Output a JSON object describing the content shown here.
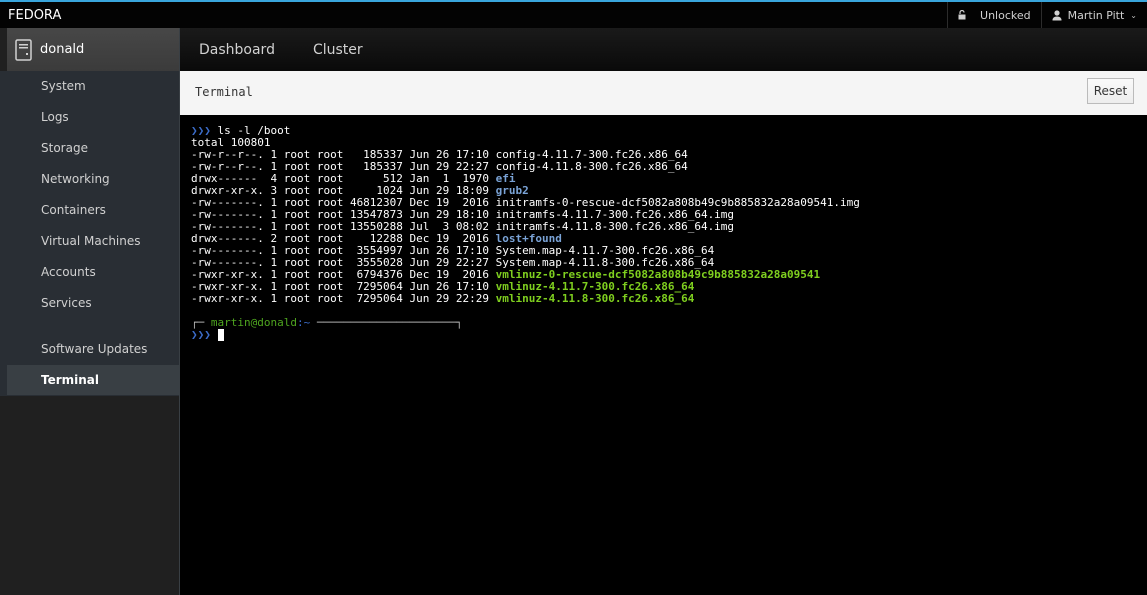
{
  "topbar": {
    "brand": "FEDORA",
    "lock_status": "Unlocked",
    "user_name": "Martin Pitt",
    "accent_color": "#39a5dc"
  },
  "sidebar": {
    "host": "donald",
    "items": [
      {
        "label": "System",
        "active": false
      },
      {
        "label": "Logs",
        "active": false
      },
      {
        "label": "Storage",
        "active": false
      },
      {
        "label": "Networking",
        "active": false
      },
      {
        "label": "Containers",
        "active": false
      },
      {
        "label": "Virtual Machines",
        "active": false
      },
      {
        "label": "Accounts",
        "active": false
      },
      {
        "label": "Services",
        "active": false
      },
      {
        "label": "Software Updates",
        "active": false
      },
      {
        "label": "Terminal",
        "active": true
      }
    ]
  },
  "mainnav": {
    "tabs": [
      "Dashboard",
      "Cluster"
    ]
  },
  "toolbar": {
    "title": "Terminal",
    "reset_label": "Reset"
  },
  "terminal": {
    "prompt_symbol": "❯❯❯",
    "command": "ls -l /boot",
    "total": "total 100801",
    "entries": [
      {
        "meta": "-rw-r--r--. 1 root root   185337 Jun 26 17:10 ",
        "name": "config-4.11.7-300.fc26.x86_64",
        "kind": "file"
      },
      {
        "meta": "-rw-r--r--. 1 root root   185337 Jun 29 22:27 ",
        "name": "config-4.11.8-300.fc26.x86_64",
        "kind": "file"
      },
      {
        "meta": "drwx------  4 root root      512 Jan  1  1970 ",
        "name": "efi",
        "kind": "dir"
      },
      {
        "meta": "drwxr-xr-x. 3 root root     1024 Jun 29 18:09 ",
        "name": "grub2",
        "kind": "dir"
      },
      {
        "meta": "-rw-------. 1 root root 46812307 Dec 19  2016 ",
        "name": "initramfs-0-rescue-dcf5082a808b49c9b885832a28a09541.img",
        "kind": "file"
      },
      {
        "meta": "-rw-------. 1 root root 13547873 Jun 29 18:10 ",
        "name": "initramfs-4.11.7-300.fc26.x86_64.img",
        "kind": "file"
      },
      {
        "meta": "-rw-------. 1 root root 13550288 Jul  3 08:02 ",
        "name": "initramfs-4.11.8-300.fc26.x86_64.img",
        "kind": "file"
      },
      {
        "meta": "drwx------. 2 root root    12288 Dec 19  2016 ",
        "name": "lost+found",
        "kind": "dir"
      },
      {
        "meta": "-rw-------. 1 root root  3554997 Jun 26 17:10 ",
        "name": "System.map-4.11.7-300.fc26.x86_64",
        "kind": "file"
      },
      {
        "meta": "-rw-------. 1 root root  3555028 Jun 29 22:27 ",
        "name": "System.map-4.11.8-300.fc26.x86_64",
        "kind": "file"
      },
      {
        "meta": "-rwxr-xr-x. 1 root root  6794376 Dec 19  2016 ",
        "name": "vmlinuz-0-rescue-dcf5082a808b49c9b885832a28a09541",
        "kind": "exec"
      },
      {
        "meta": "-rwxr-xr-x. 1 root root  7295064 Jun 26 17:10 ",
        "name": "vmlinuz-4.11.7-300.fc26.x86_64",
        "kind": "exec"
      },
      {
        "meta": "-rwxr-xr-x. 1 root root  7295064 Jun 29 22:29 ",
        "name": "vmlinuz-4.11.8-300.fc26.x86_64",
        "kind": "exec"
      }
    ],
    "prompt_corner": "┌─ ",
    "user_host": "martin@donald",
    "cwd": ":~",
    "prompt_rule": " ─────────────────────┐"
  }
}
